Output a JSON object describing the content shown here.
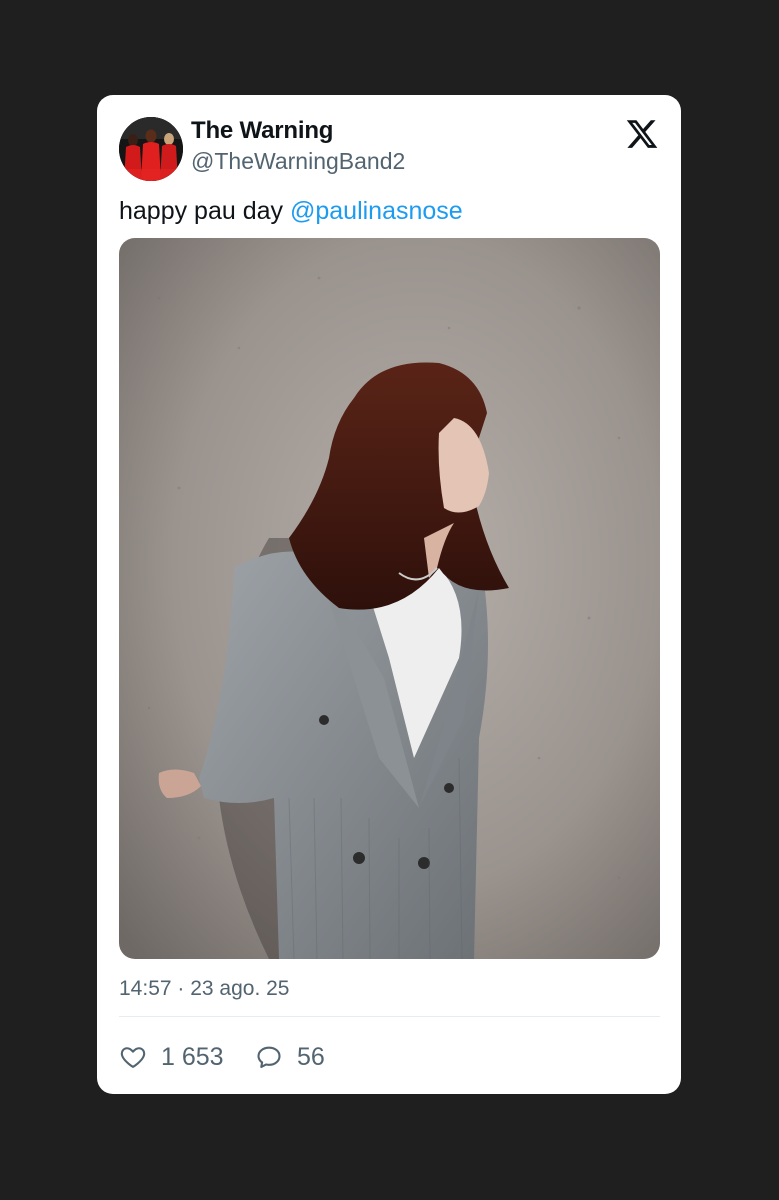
{
  "tweet": {
    "author": {
      "name": "The Warning",
      "handle": "@TheWarningBand2",
      "avatar_icon": "avatar-photo"
    },
    "platform_icon": "x-logo-icon",
    "text": "happy pau day ",
    "mention": "@paulinasnose",
    "timestamp": "14:57 · 23 ago. 25",
    "likes": "1 653",
    "replies": "56",
    "colors": {
      "text": "#0f1419",
      "secondary": "#536471",
      "link": "#1d9bf0",
      "background": "#1f1f1f",
      "card": "#ffffff"
    }
  }
}
